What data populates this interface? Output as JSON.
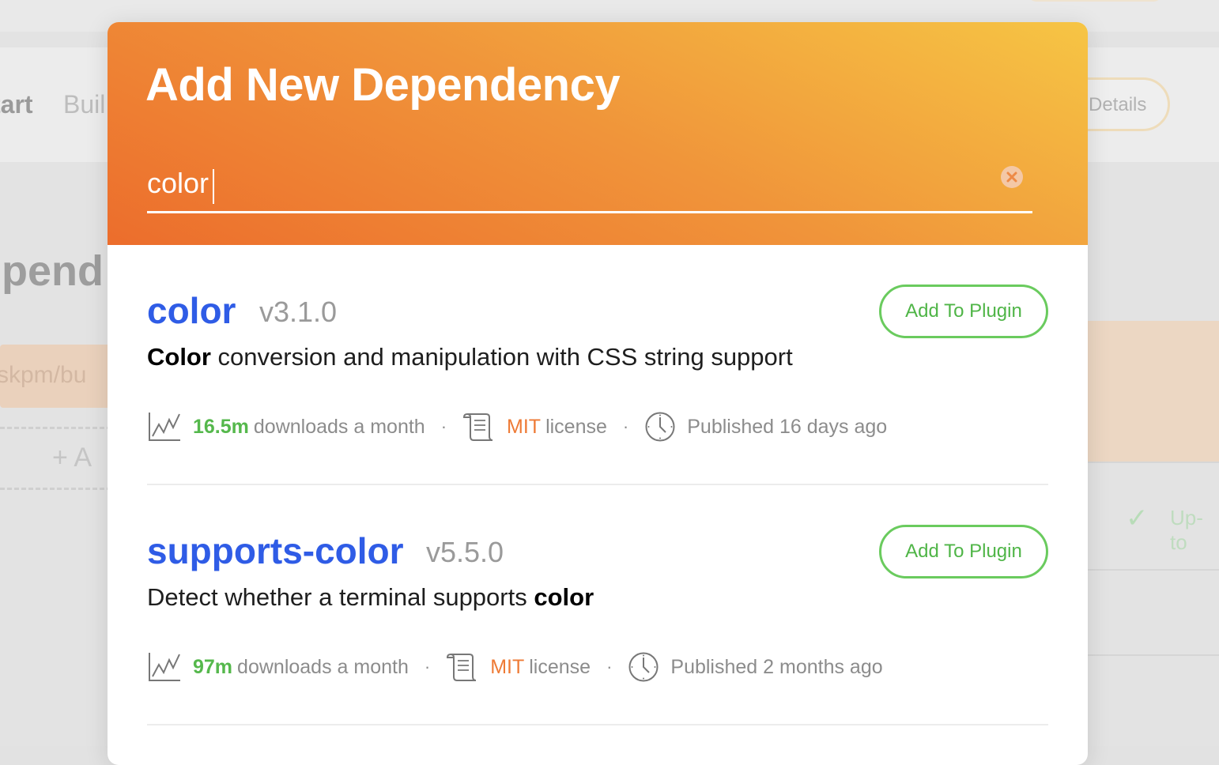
{
  "background": {
    "tabs": [
      "tart",
      "Buil"
    ],
    "details_label": "Details",
    "heading": "pend",
    "chip_text": "skpm/bu",
    "add_label": "+ A",
    "status_label": "Up-to"
  },
  "modal": {
    "title": "Add New Dependency",
    "search": {
      "value": "color"
    }
  },
  "results": [
    {
      "name": "color",
      "version": "v3.1.0",
      "desc_bold": "Color",
      "desc_rest": " conversion and manipulation with CSS string support",
      "downloads": "16.5m",
      "downloads_suffix": "downloads a month",
      "license": "MIT",
      "license_suffix": "license",
      "published": "Published 16 days ago",
      "button": "Add To Plugin"
    },
    {
      "name": "supports-color",
      "version": "v5.5.0",
      "desc_rest": "Detect whether a terminal supports ",
      "desc_bold": "color",
      "downloads": "97m",
      "downloads_suffix": "downloads a month",
      "license": "MIT",
      "license_suffix": "license",
      "published": "Published 2 months ago",
      "button": "Add To Plugin"
    }
  ],
  "separator": "·",
  "colors": {
    "accent": "#2f5ce6",
    "success": "#55b84c",
    "license": "#ee7a35",
    "header_start": "#ec6d2c",
    "header_end": "#f6c544"
  },
  "icons": [
    "chart-icon",
    "scroll-icon",
    "clock-icon",
    "clear-icon"
  ]
}
